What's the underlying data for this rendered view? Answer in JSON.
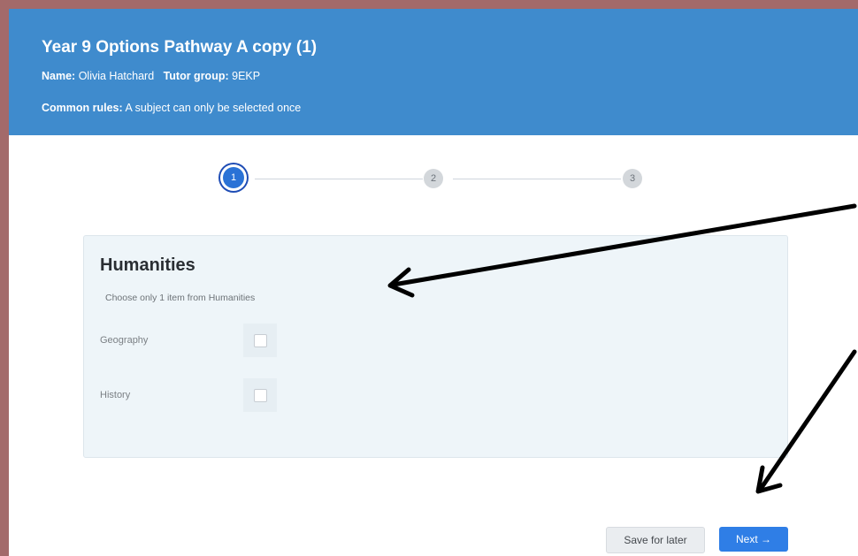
{
  "header": {
    "title": "Year 9 Options Pathway A copy (1)",
    "name_label": "Name:",
    "name_value": "Olivia Hatchard",
    "tutor_label": "Tutor group:",
    "tutor_value": "9EKP",
    "rules_label": "Common rules:",
    "rules_value": "A subject can only be selected once"
  },
  "stepper": {
    "steps": [
      "1",
      "2",
      "3"
    ],
    "active_step": 1
  },
  "card": {
    "title": "Humanities",
    "subtitle": "Choose only 1 item from Humanities",
    "options": [
      {
        "label": "Geography",
        "checked": false
      },
      {
        "label": "History",
        "checked": false
      }
    ]
  },
  "actions": {
    "save_label": "Save for later",
    "next_label": "Next →"
  },
  "colors": {
    "header_bg": "#3f8bcd",
    "primary": "#2f7ee6",
    "border_frame": "#a36a6a",
    "annotation_arrow": "#000000"
  }
}
